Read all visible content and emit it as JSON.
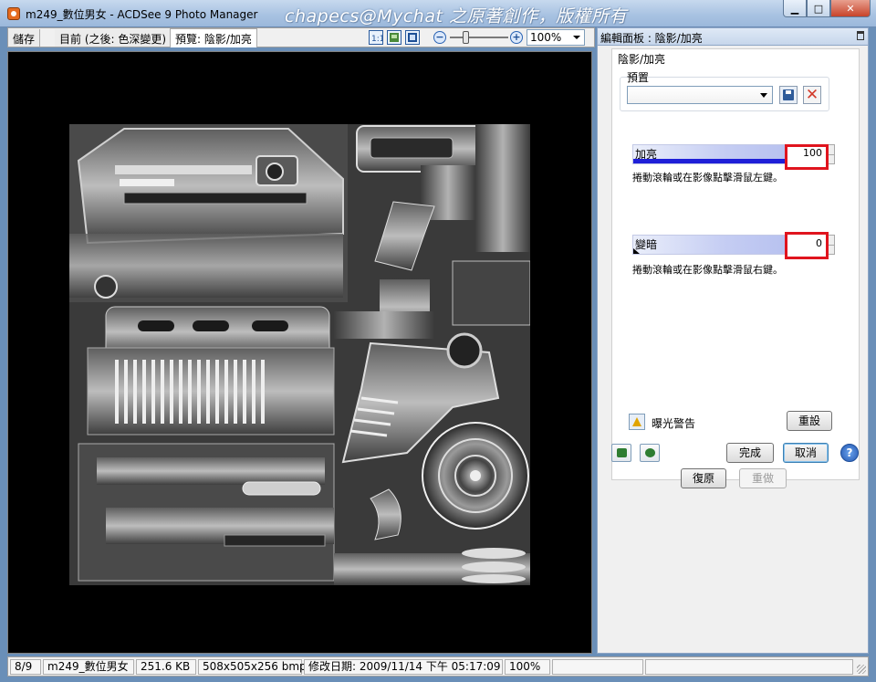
{
  "window": {
    "title": "m249_數位男女 - ACDSee 9 Photo Manager",
    "watermark": "chapecs@Mychat 之原著創作，版權所有",
    "min_label": "▁",
    "max_label": "□",
    "close_label": "✕"
  },
  "tabs": [
    {
      "label": "儲存"
    },
    {
      "label": "目前 (之後: 色深變更)"
    },
    {
      "label": "預覽: 陰影/加亮"
    }
  ],
  "toolbar": {
    "zoom_value": "100%",
    "zoom_minus": "−",
    "zoom_plus": "+"
  },
  "panel": {
    "header": "編輯面板 : 陰影/加亮",
    "section_title": "陰影/加亮",
    "preset_label": "預置",
    "preset_value": "",
    "lighten": {
      "label": "加亮",
      "value": "100",
      "level": 1.0,
      "hint": "捲動滾輪或在影像點擊滑鼠左鍵。"
    },
    "darken": {
      "label": "變暗",
      "value": "0",
      "level": 0.0,
      "hint": "捲動滾輪或在影像點擊滑鼠右鍵。"
    },
    "exposure_warning": "曝光警告",
    "reset": "重設",
    "done": "完成",
    "cancel": "取消",
    "help": "?",
    "undo": "復原",
    "redo": "重做"
  },
  "status": {
    "index": "8/9",
    "filename": "m249_數位男女",
    "filesize": "251.6 KB",
    "dimensions": "508x505x256 bmp",
    "modified": "修改日期: 2009/11/14 下午 05:17:09",
    "zoom": "100%"
  },
  "colors": {
    "highlight": "#e0141e",
    "slider_fill": "#1f1fd8"
  }
}
